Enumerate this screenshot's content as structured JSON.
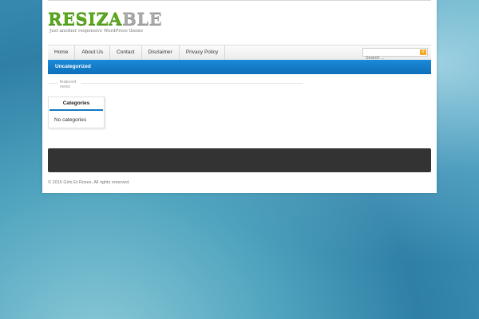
{
  "site": {
    "logo_part1": "RESIZA",
    "logo_part2": "BLE",
    "tagline": "Just another responsive WordPress theme"
  },
  "nav": {
    "items": [
      {
        "label": "Home"
      },
      {
        "label": "About Us"
      },
      {
        "label": "Contact"
      },
      {
        "label": "Disclaimer"
      },
      {
        "label": "Privacy Policy"
      }
    ]
  },
  "search": {
    "placeholder": "Search ..."
  },
  "category_bar": {
    "label": "Uncategorized"
  },
  "featured": {
    "label": "featured news"
  },
  "widget": {
    "title": "Categories",
    "body": "No categories"
  },
  "footer": {
    "copyright": "© 2015 Girls Et Roses. All rights reserved."
  },
  "colors": {
    "accent_blue": "#1477c2",
    "logo_green": "#5aa81c",
    "search_button": "#f5a623",
    "footer_dark": "#333333"
  }
}
